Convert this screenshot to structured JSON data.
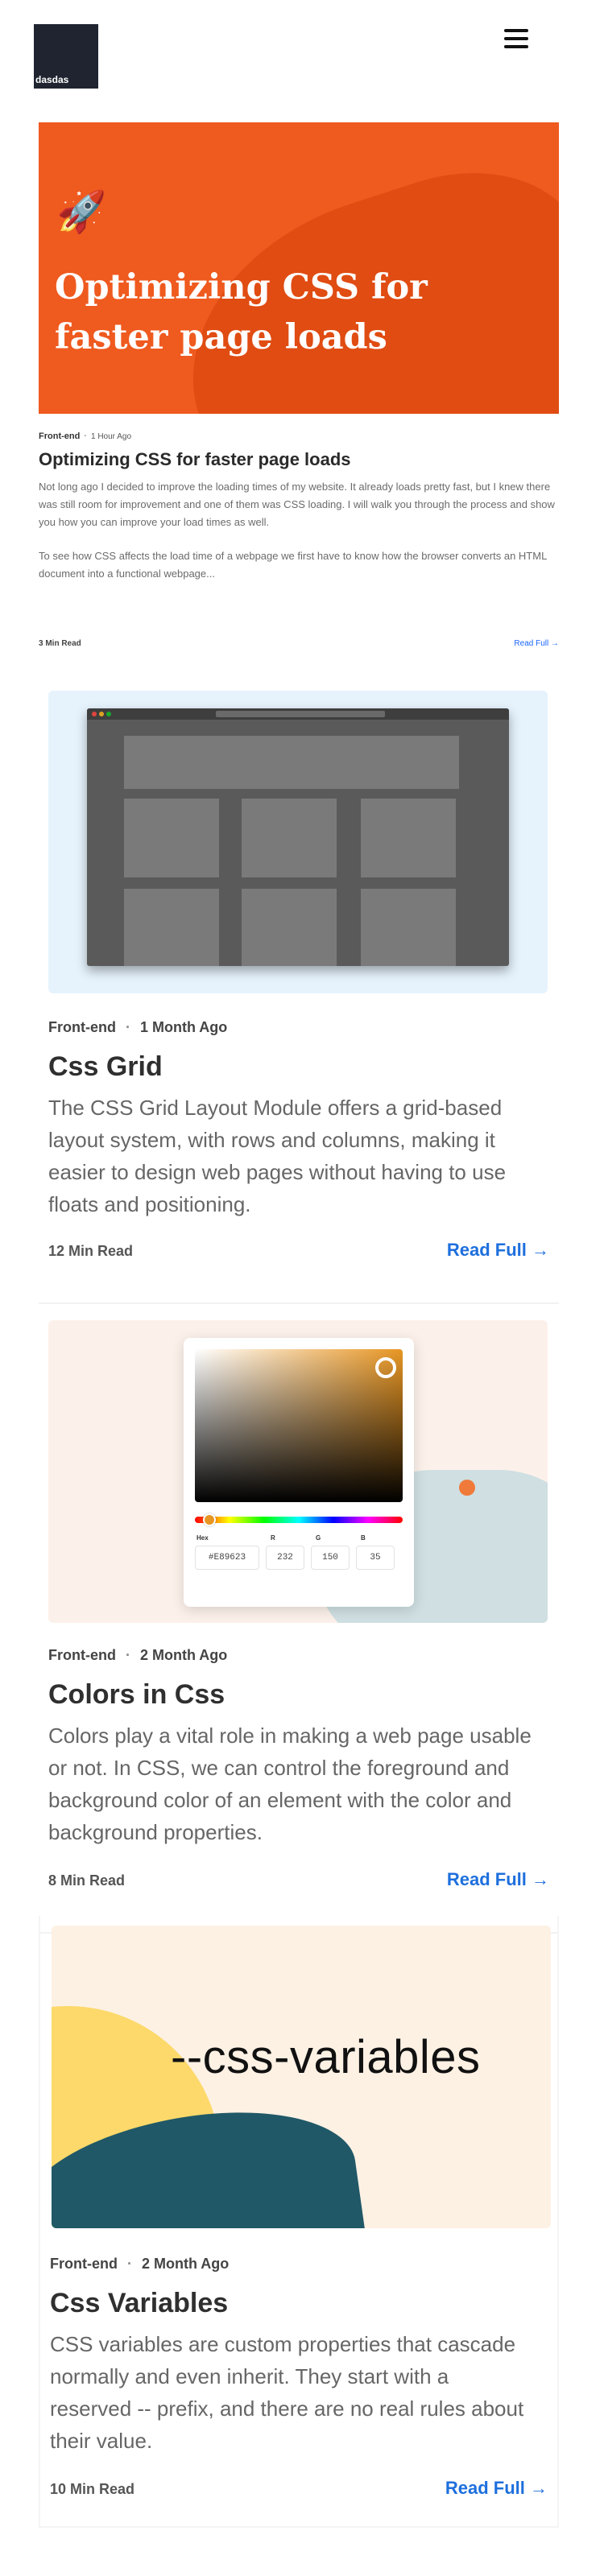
{
  "header": {
    "logo_text": "dasdas",
    "menu_icon": "hamburger-icon"
  },
  "featured": {
    "hero_title": "Optimizing CSS for faster page loads",
    "hero_icon": "rocket-icon",
    "category": "Front-end",
    "time_ago": "1 Hour Ago",
    "title": "Optimizing CSS for faster page loads",
    "excerpt_1": "Not long ago I decided to improve the loading times of my website. It already loads pretty fast, but I knew there was still room for improvement and one of them was CSS loading. I will walk you through the process and show you how you can improve your load times as well.",
    "excerpt_2": "To see how CSS affects the load time of a webpage we first have to know how the browser converts an HTML document into a functional webpage...",
    "read_time": "3 Min Read",
    "read_full": "Read Full →"
  },
  "posts": [
    {
      "category": "Front-end",
      "time_ago": "1 Month Ago",
      "title": "Css Grid",
      "excerpt": "The CSS Grid Layout Module offers a grid-based layout system, with rows and columns, making it easier to design web pages without having to use floats and positioning.",
      "read_time": "12 Min Read",
      "read_full": "Read Full →"
    },
    {
      "category": "Front-end",
      "time_ago": "2 Month Ago",
      "title": "Colors in Css",
      "excerpt": "Colors play a vital role in making a web page usable or not. In CSS, we can control the foreground and background color of an element with the color and background properties.",
      "read_time": "8 Min Read",
      "read_full": "Read Full →",
      "picker": {
        "label_hex": "Hex",
        "label_r": "R",
        "label_g": "G",
        "label_b": "B",
        "hex": "#E89623",
        "r": "232",
        "g": "150",
        "b": "35"
      }
    },
    {
      "category": "Front-end",
      "time_ago": "2 Month Ago",
      "title": "Css Variables",
      "excerpt": "CSS variables are custom properties that cascade normally and even inherit. They start with a reserved -- prefix, and there are no real rules about their value.",
      "read_time": "10 Min Read",
      "read_full": "Read Full →",
      "thumb_text": "--css-variables"
    }
  ],
  "colors": {
    "hero_orange": "#ef5a1f",
    "link_blue": "#1e6fdd",
    "picked_color": "#e89623"
  }
}
